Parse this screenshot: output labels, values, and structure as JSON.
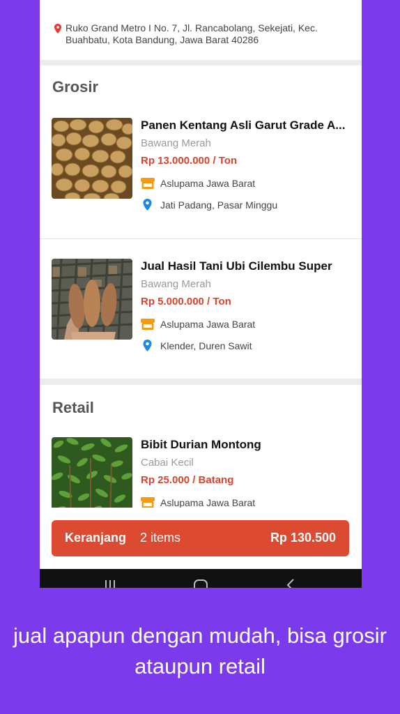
{
  "store": {
    "address": "Ruko Grand Metro I No. 7, Jl. Rancabolang, Sekejati, Kec. Buahbatu, Kota Bandung, Jawa Barat 40286"
  },
  "sections": [
    {
      "title": "Grosir",
      "products": [
        {
          "name": "Panen Kentang Asli Garut Grade A...",
          "category": "Bawang Merah",
          "price": "Rp 13.000.000 / Ton",
          "seller": "Aslupama Jawa Barat",
          "location": "Jati Padang, Pasar Minggu",
          "image_icon": "potatoes-image"
        },
        {
          "name": "Jual Hasil Tani Ubi Cilembu Super",
          "category": "Bawang Merah",
          "price": "Rp 5.000.000 / Ton",
          "seller": "Aslupama Jawa Barat",
          "location": "Klender, Duren Sawit",
          "image_icon": "sweet-potatoes-image"
        }
      ]
    },
    {
      "title": "Retail",
      "products": [
        {
          "name": "Bibit Durian Montong",
          "category": "Cabai Kecil",
          "price": "Rp 25.000 / Batang",
          "seller": "Aslupama Jawa Barat",
          "image_icon": "durian-seedlings-image"
        }
      ]
    }
  ],
  "cart": {
    "label": "Keranjang",
    "count": "2 items",
    "total": "Rp 130.500"
  },
  "caption": "jual apapun dengan mudah, bisa grosir ataupun retail",
  "colors": {
    "background": "#7c3aed",
    "price": "#d9442d",
    "cart_button": "#dc4a32",
    "seller_icon": "#f39c12",
    "location_icon": "#1e88e5",
    "address_pin": "#e53935"
  }
}
